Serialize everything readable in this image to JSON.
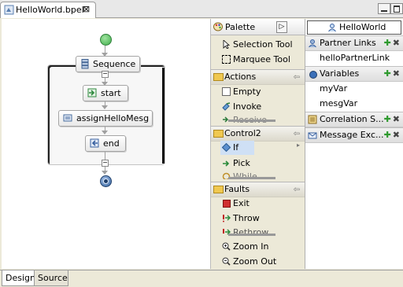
{
  "editor": {
    "tab_title": "HelloWorld.bpel",
    "tab_close": "⊠"
  },
  "process": {
    "sequence_label": "Sequence",
    "activities": [
      "start",
      "assignHelloMesg",
      "end"
    ]
  },
  "palette": {
    "title": "Palette",
    "tools": [
      "Selection Tool",
      "Marquee Tool"
    ],
    "groups": [
      {
        "label": "Actions",
        "items": [
          "Empty",
          "Invoke",
          "Receive"
        ]
      },
      {
        "label": "Control2",
        "items": [
          "If",
          "Pick",
          "While"
        ]
      },
      {
        "label": "Faults",
        "items": [
          "Exit",
          "Throw",
          "Rethrow",
          "Zoom In",
          "Zoom Out"
        ]
      }
    ]
  },
  "outline": {
    "process_name": "HelloWorld",
    "sections": [
      {
        "label": "Partner Links",
        "items": [
          "helloPartnerLink"
        ]
      },
      {
        "label": "Variables",
        "items": [
          "myVar",
          "mesgVar"
        ]
      },
      {
        "label": "Correlation S...",
        "items": []
      },
      {
        "label": "Message Exc...",
        "items": []
      }
    ]
  },
  "bottom_tabs": [
    "Design",
    "Source"
  ],
  "colors": {
    "start_node": "#3fae4a",
    "end_node": "#2f5f9a",
    "selected_item": "#cfe0f5",
    "add_action": "#2e9a2e"
  }
}
